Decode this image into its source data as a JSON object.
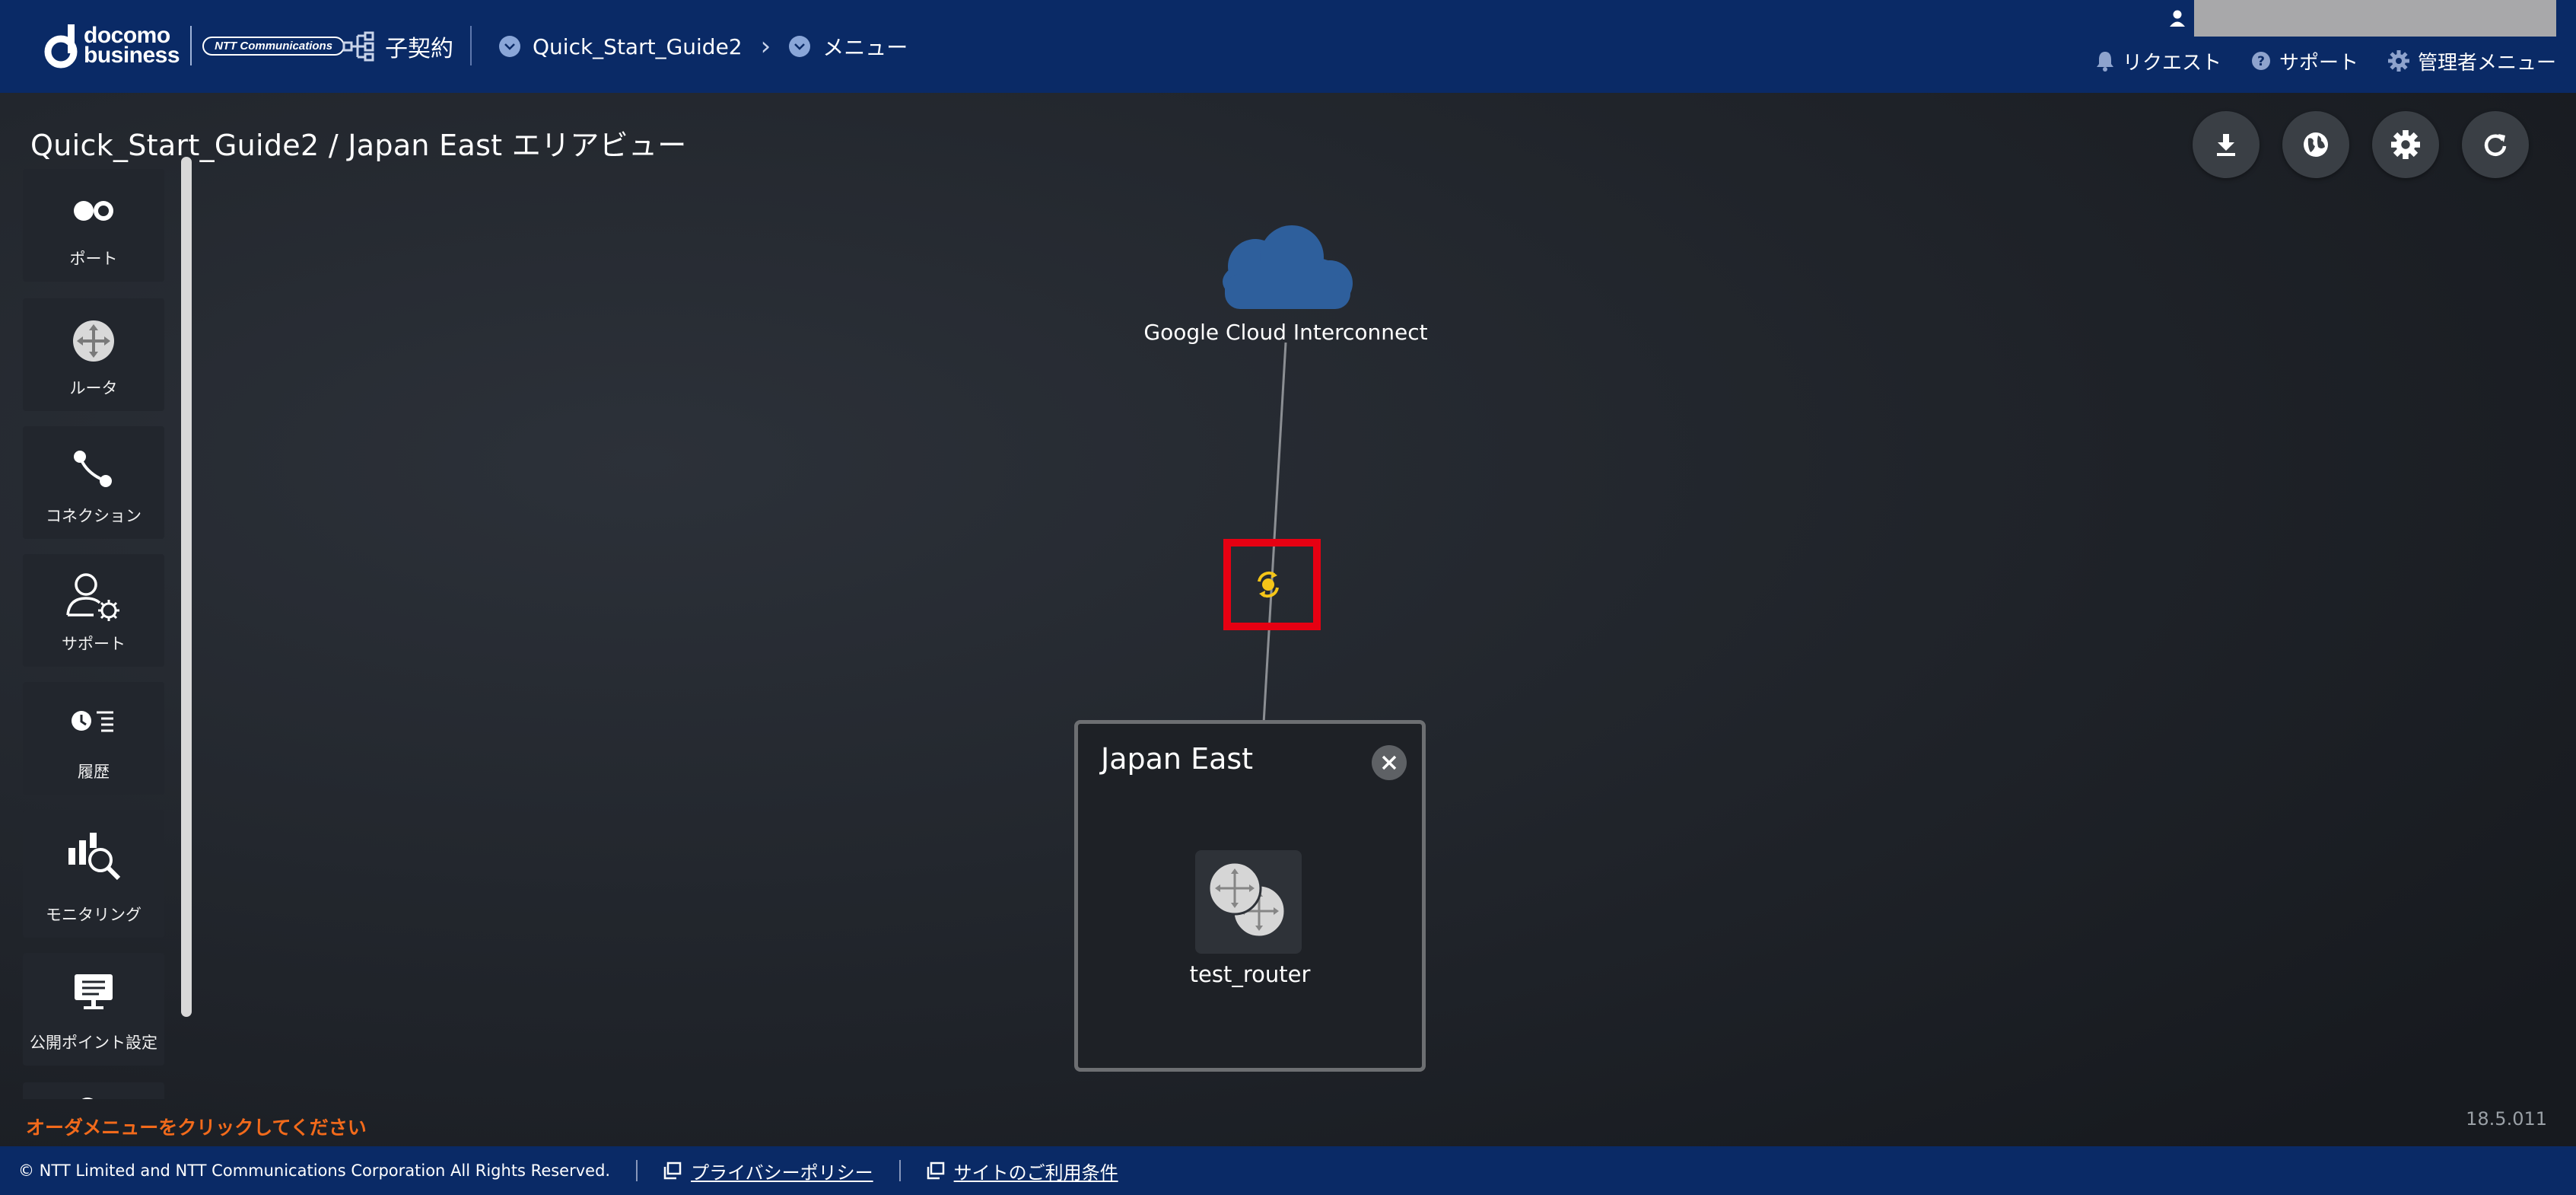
{
  "header": {
    "logo_line1": "docomo",
    "logo_line2": "business",
    "logo_ntt": "NTT Communications",
    "sub_contract": "子契約",
    "breadcrumb": [
      "Quick_Start_Guide2",
      "メニュー"
    ],
    "links": [
      {
        "label": "リクエスト",
        "icon": "bell-icon"
      },
      {
        "label": "サポート",
        "icon": "help-icon"
      },
      {
        "label": "管理者メニュー",
        "icon": "gear-icon"
      }
    ]
  },
  "page": {
    "title": "Quick_Start_Guide2 / Japan East エリアビュー"
  },
  "toolbar": [
    {
      "name": "download-button",
      "icon": "download-icon"
    },
    {
      "name": "globe-button",
      "icon": "globe-icon"
    },
    {
      "name": "settings-button",
      "icon": "gear-icon"
    },
    {
      "name": "refresh-button",
      "icon": "refresh-icon"
    }
  ],
  "palette": [
    {
      "label": "ポート",
      "icon": "port-icon"
    },
    {
      "label": "ルータ",
      "icon": "router-icon"
    },
    {
      "label": "コネクション",
      "icon": "connection-icon"
    },
    {
      "label": "サポート",
      "icon": "support-user-icon"
    },
    {
      "label": "履歴",
      "icon": "history-icon"
    },
    {
      "label": "モニタリング",
      "icon": "monitoring-icon"
    },
    {
      "label": "公開ポイント設定",
      "icon": "display-icon"
    }
  ],
  "canvas": {
    "cloud_label": "Google Cloud Interconnect",
    "region_title": "Japan East",
    "router_label": "test_router",
    "status_color": "#f5c518"
  },
  "status": {
    "order_message": "オーダメニューをクリックしてください",
    "version": "18.5.011"
  },
  "footer": {
    "copyright": "© NTT Limited and NTT Communications Corporation All Rights Reserved.",
    "privacy": "プライバシーポリシー",
    "terms": "サイトのご利用条件"
  },
  "colors": {
    "header_bg": "#0a2a66",
    "highlight": "#e60012",
    "order_message": "#f26a1b"
  }
}
